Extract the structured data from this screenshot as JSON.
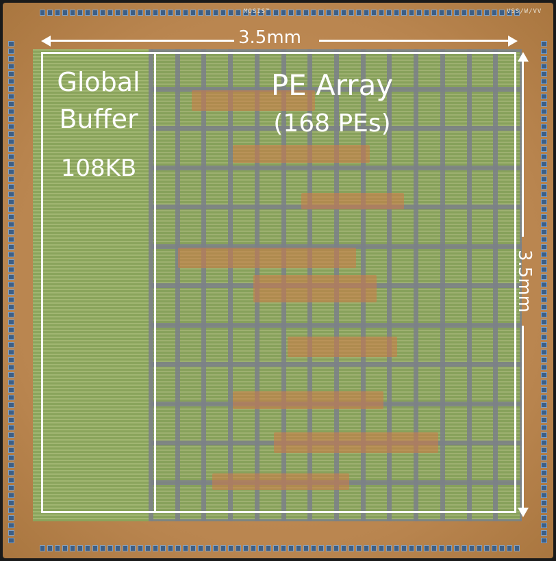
{
  "chip": {
    "global_buffer_title": "Global\nBuffer",
    "global_buffer_line1": "Global",
    "global_buffer_line2": "Buffer",
    "global_buffer_size": "108KB",
    "pe_array_title": "PE Array",
    "pe_array_count": "(168 PEs)",
    "width_label": "3.5mm",
    "height_label": "3.5mm",
    "marking_top": "MOSIS™",
    "marking_top_right": "VSS/W/VV"
  },
  "colors": {
    "die": "#b9854f",
    "core": "#8ea862",
    "pad": "#3d5f86",
    "grid": "#7b8088",
    "outline": "#ffffff"
  }
}
